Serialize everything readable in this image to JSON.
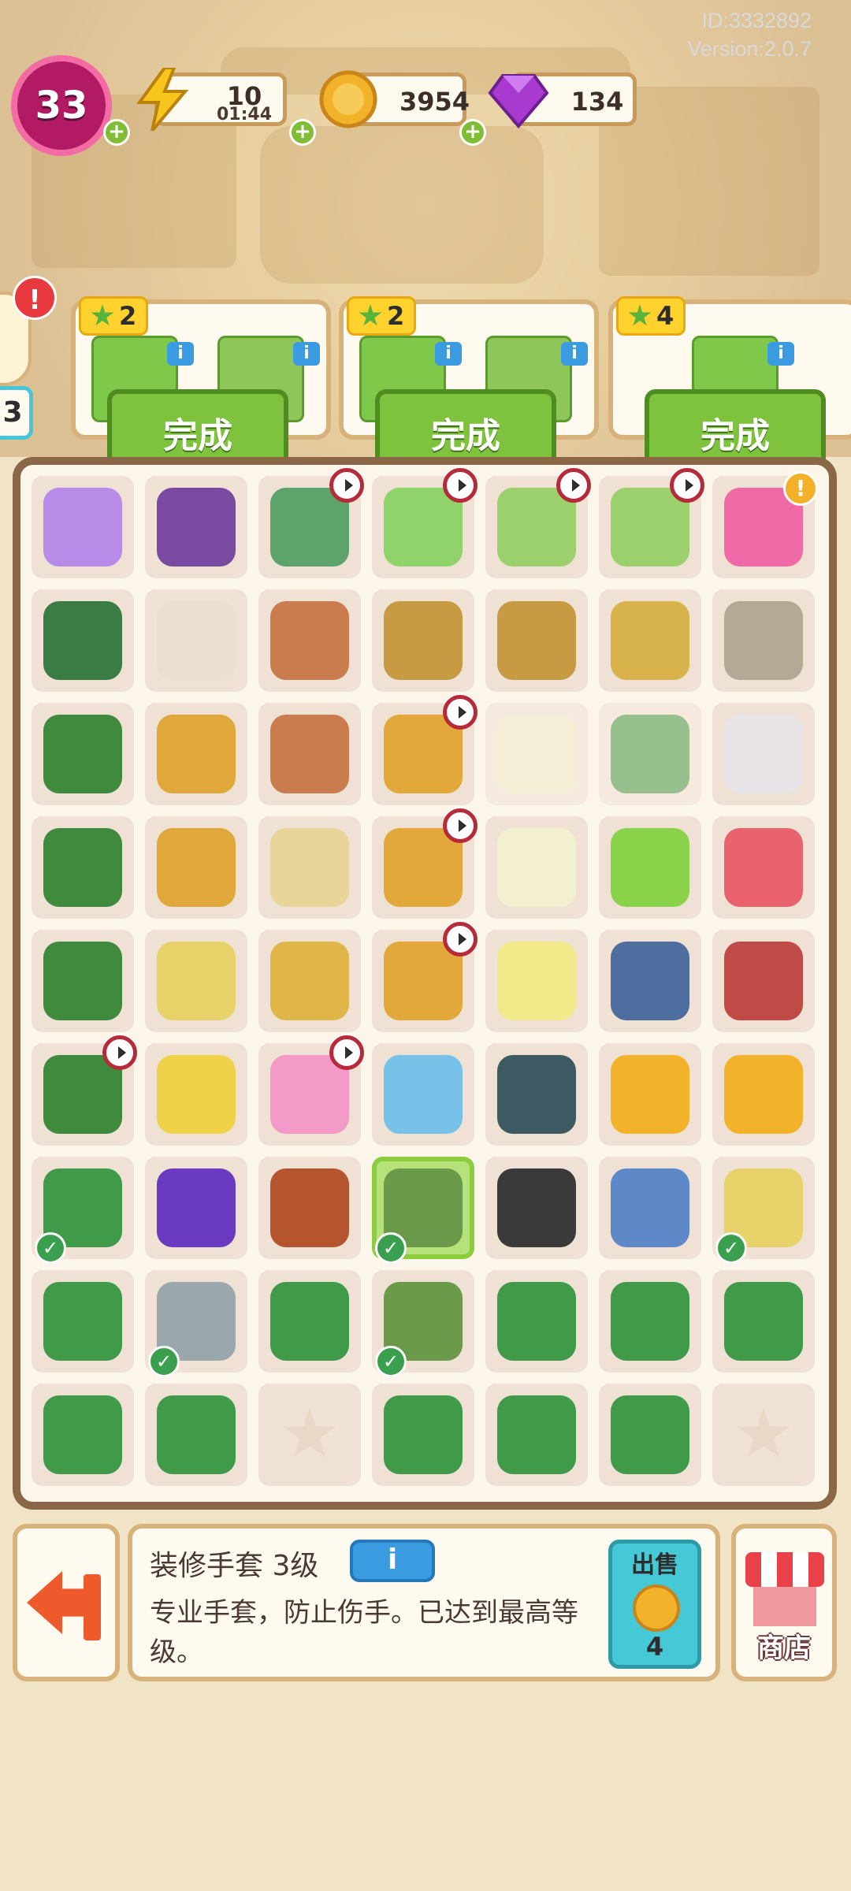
{
  "meta": {
    "id": "ID:3332892",
    "version": "Version:2.0.7"
  },
  "hud": {
    "level": "33",
    "energy": {
      "value": "10",
      "timer": "01:44",
      "icon": "lightning-icon",
      "color": "#f7c51d"
    },
    "coins": {
      "value": "3954",
      "icon": "coin-icon",
      "color": "#f2b32a"
    },
    "gems": {
      "value": "134",
      "icon": "gem-icon",
      "color": "#a83ad0"
    }
  },
  "orders": [
    {
      "stars": "2",
      "items": [
        "drill-kit-icon",
        "gloves-icon"
      ],
      "button": "完成"
    },
    {
      "stars": "2",
      "items": [
        "drill-kit-icon",
        "gloves-icon"
      ],
      "button": "完成"
    },
    {
      "stars": "4",
      "items": [
        "drill-icon"
      ],
      "button": "完成"
    }
  ],
  "side": {
    "alert": "!",
    "number": "3"
  },
  "grid": [
    [
      {
        "icon": "energy-cushion-icon",
        "color": "#b98be8"
      },
      {
        "icon": "tool-crate-icon",
        "color": "#7a4aa0"
      },
      {
        "icon": "radio-icon",
        "color": "#5ea36b",
        "clock": true
      },
      {
        "icon": "tv-icon",
        "color": "#8fd36a",
        "clock": true
      },
      {
        "icon": "laptop-icon",
        "color": "#9bd06c",
        "clock": true
      },
      {
        "icon": "laptop-icon",
        "color": "#9bd06c",
        "clock": true
      },
      {
        "icon": "backpack-icon",
        "color": "#f06aa8",
        "bubble": "!"
      }
    ],
    [
      {
        "icon": "handle-icon",
        "color": "#3a7d44"
      },
      {
        "icon": "paint-can-icon",
        "color": "#e9e0d2"
      },
      {
        "icon": "flower-pot-icon",
        "color": "#c97d4e"
      },
      {
        "icon": "nest-icon",
        "color": "#c79a44"
      },
      {
        "icon": "basket-icon",
        "color": "#c79a44"
      },
      {
        "icon": "flower-basket-icon",
        "color": "#d8b24a"
      },
      {
        "icon": "statue-icon",
        "color": "#b5a995"
      }
    ],
    [
      {
        "icon": "toolbox-icon",
        "color": "#3f8a3c"
      },
      {
        "icon": "wood-planks-icon",
        "color": "#e0a83a"
      },
      {
        "icon": "broken-pot-icon",
        "color": "#c97d4e"
      },
      {
        "icon": "cabinet-icon",
        "color": "#e3a83a",
        "clock": true
      },
      {
        "icon": "frame-icon",
        "color": "#f2f0cf",
        "locked": true
      },
      {
        "icon": "megaphone-icon",
        "color": "#4a9a4a",
        "locked": true
      },
      {
        "icon": "box-icon",
        "color": "#e8e4e8"
      }
    ],
    [
      {
        "icon": "toolbox-icon",
        "color": "#3f8a3c"
      },
      {
        "icon": "crate-icon",
        "color": "#e0a83a"
      },
      {
        "icon": "glass-pot-icon",
        "color": "#e9d49a"
      },
      {
        "icon": "cabinet-icon",
        "color": "#e3a83a",
        "clock": true
      },
      {
        "icon": "frame-icon",
        "color": "#f2f0cf"
      },
      {
        "icon": "tree-icon",
        "color": "#8ad24a"
      },
      {
        "icon": "planter-icon",
        "color": "#e9626e"
      }
    ],
    [
      {
        "icon": "toolbox-icon",
        "color": "#3f8a3c"
      },
      {
        "icon": "cart-icon",
        "color": "#e8d26a"
      },
      {
        "icon": "plant-pot-icon",
        "color": "#e0b64a"
      },
      {
        "icon": "dresser-icon",
        "color": "#e3a83a",
        "clock": true
      },
      {
        "icon": "basket-icon",
        "color": "#f2e98a"
      },
      {
        "icon": "dumbbell-icon",
        "color": "#4e6ea0"
      },
      {
        "icon": "wheelbarrow-icon",
        "color": "#c04a45"
      }
    ],
    [
      {
        "icon": "toolbox-icon",
        "color": "#3f8a3c",
        "clock": true
      },
      {
        "icon": "cart-icon",
        "color": "#f0d24a"
      },
      {
        "icon": "lunchbox-icon",
        "color": "#f39ac8",
        "clock": true
      },
      {
        "icon": "printer-icon",
        "color": "#78c2ea"
      },
      {
        "icon": "gear-cart-icon",
        "color": "#3d5a63"
      },
      {
        "icon": "coins-icon",
        "color": "#f2b32a"
      },
      {
        "icon": "medal-icon",
        "color": "#f2b32a"
      }
    ],
    [
      {
        "icon": "saw-drill-icon",
        "color": "#3f9a4a",
        "check": true
      },
      {
        "icon": "goggles-icon",
        "color": "#6a3ac0"
      },
      {
        "icon": "wallet-icon",
        "color": "#b5552f"
      },
      {
        "icon": "gloves-icon",
        "color": "#6a9a4a",
        "selected": true,
        "check": true
      },
      {
        "icon": "tire-icon",
        "color": "#3a3a3a"
      },
      {
        "icon": "bench-icon",
        "color": "#5f88c9"
      },
      {
        "icon": "paint-bucket-icon",
        "color": "#e8d26a",
        "check": true
      }
    ],
    [
      {
        "icon": "hacksaw-icon",
        "color": "#3f9a4a"
      },
      {
        "icon": "wrench-icon",
        "color": "#9aa7ad",
        "check": true
      },
      {
        "icon": "allen-key-icon",
        "color": "#3f9a4a"
      },
      {
        "icon": "gloves-icon",
        "color": "#6a9a4a",
        "check": true
      },
      {
        "icon": "hook-icon",
        "color": "#3f9a4a"
      },
      {
        "icon": "hook-icon",
        "color": "#3f9a4a"
      },
      {
        "icon": "screwdriver-icon",
        "color": "#3f9a4a"
      }
    ],
    [
      {
        "icon": "pliers-icon",
        "color": "#3f9a4a"
      },
      {
        "icon": "hook-icon",
        "color": "#3f9a4a"
      },
      {
        "icon": "empty-star-icon",
        "empty": true
      },
      {
        "icon": "screwdriver-icon",
        "color": "#3f9a4a"
      },
      {
        "icon": "hook-icon",
        "color": "#3f9a4a"
      },
      {
        "icon": "hook-icon",
        "color": "#3f9a4a"
      },
      {
        "icon": "empty-star-icon",
        "empty": true
      }
    ]
  ],
  "info": {
    "title": "装修手套 3级",
    "info_button": "i",
    "description": "专业手套，防止伤手。已达到最高等级。",
    "sell_label": "出售",
    "sell_value": "4"
  },
  "shop": {
    "label": "商店"
  }
}
